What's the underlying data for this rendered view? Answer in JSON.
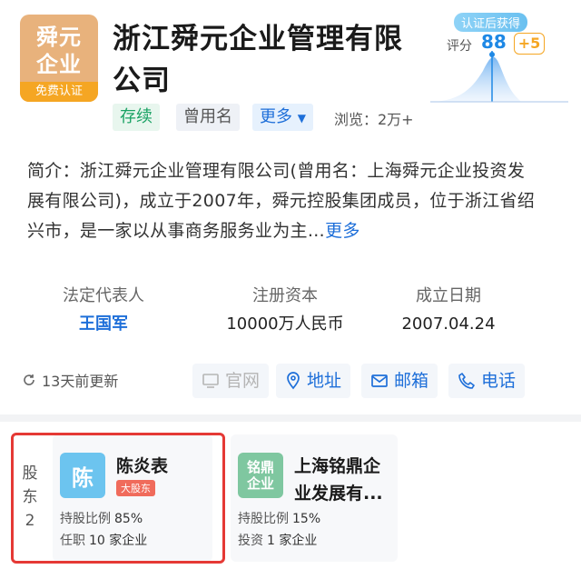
{
  "company": {
    "logo_text": "舜元\n企业",
    "logo_badge": "免费认证",
    "name": "浙江舜元企业管理有限公司"
  },
  "score": {
    "badge": "认证后获得",
    "label": "评分",
    "value": "88",
    "bonus": "+5"
  },
  "tags": {
    "status": "存续",
    "former_name": "曾用名",
    "more": "更多",
    "views_label": "浏览：2万+"
  },
  "intro": {
    "text": "简介：浙江舜元企业管理有限公司(曾用名：上海舜元企业投资发展有限公司)，成立于2007年，舜元控股集团成员，位于浙江省绍兴市，是一家以从事商务服务业为主…",
    "more": "更多"
  },
  "stats": [
    {
      "label": "法定代表人",
      "value": "王国军"
    },
    {
      "label": "注册资本",
      "value": "10000万人民币"
    },
    {
      "label": "成立日期",
      "value": "2007.04.24"
    }
  ],
  "actions": {
    "updated": "13天前更新",
    "website": "官网",
    "address": "地址",
    "email": "邮箱",
    "phone": "电话"
  },
  "shareholders": {
    "section_label": "股东",
    "count": "2",
    "items": [
      {
        "avatar": "陈",
        "name": "陈炎表",
        "badge": "大股东",
        "ratio_label": "持股比例",
        "ratio": "85%",
        "extra_label": "任职",
        "extra_value": "10 家企业"
      },
      {
        "avatar": "铭鼎\n企业",
        "name": "上海铭鼎企业发展有...",
        "ratio_label": "持股比例",
        "ratio": "15%",
        "extra_label": "投资",
        "extra_value": "1 家企业"
      }
    ]
  }
}
